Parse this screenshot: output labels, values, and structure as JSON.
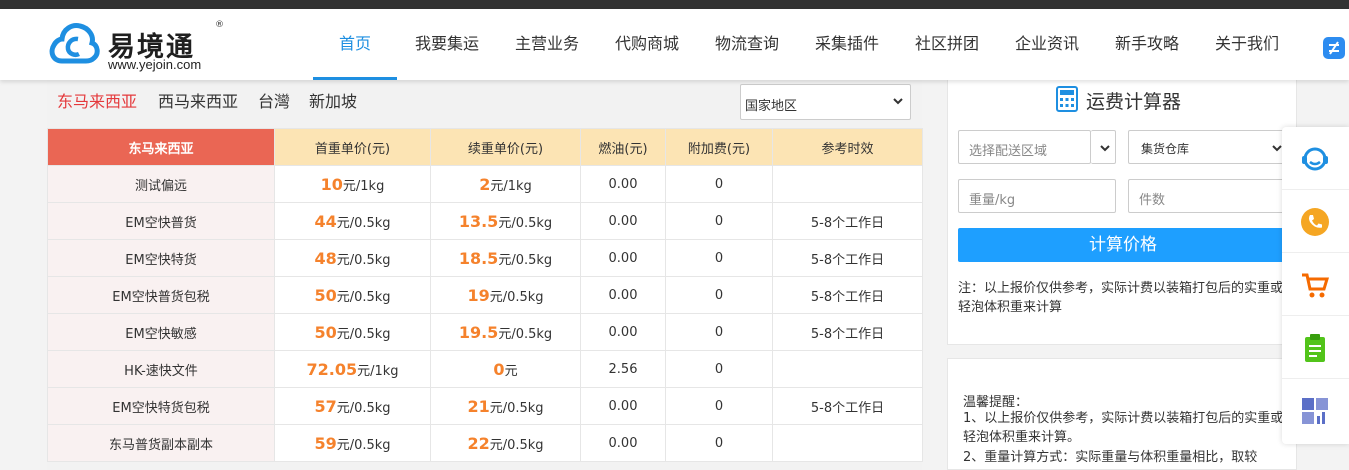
{
  "header": {
    "brand_name": "易境通",
    "brand_reg": "®",
    "brand_url": "www.yejoin.com",
    "nav": [
      {
        "label": "首页",
        "active": true
      },
      {
        "label": "我要集运"
      },
      {
        "label": "主营业务"
      },
      {
        "label": "代购商城"
      },
      {
        "label": "物流查询"
      },
      {
        "label": "采集插件"
      },
      {
        "label": "社区拼团"
      },
      {
        "label": "企业资讯"
      },
      {
        "label": "新手攻略"
      },
      {
        "label": "关于我们"
      }
    ]
  },
  "regions": {
    "tabs": [
      "东马来西亚",
      "西马来西亚",
      "台灣",
      "新加坡"
    ],
    "active": "东马来西亚",
    "select_value": "国家地区"
  },
  "rates_table": {
    "headers": [
      "东马来西亚",
      "首重单价(元)",
      "续重单价(元)",
      "燃油(元)",
      "附加费(元)",
      "参考时效"
    ],
    "rows": [
      {
        "name": "测试偏远",
        "first_price": "10",
        "first_unit": "元/1kg",
        "cont_price": "2",
        "cont_unit": "元/1kg",
        "fuel": "0.00",
        "surcharge": "0",
        "eta": ""
      },
      {
        "name": "EM空快普货",
        "first_price": "44",
        "first_unit": "元/0.5kg",
        "cont_price": "13.5",
        "cont_unit": "元/0.5kg",
        "fuel": "0.00",
        "surcharge": "0",
        "eta": "5-8个工作日"
      },
      {
        "name": "EM空快特货",
        "first_price": "48",
        "first_unit": "元/0.5kg",
        "cont_price": "18.5",
        "cont_unit": "元/0.5kg",
        "fuel": "0.00",
        "surcharge": "0",
        "eta": "5-8个工作日"
      },
      {
        "name": "EM空快普货包税",
        "first_price": "50",
        "first_unit": "元/0.5kg",
        "cont_price": "19",
        "cont_unit": "元/0.5kg",
        "fuel": "0.00",
        "surcharge": "0",
        "eta": "5-8个工作日"
      },
      {
        "name": "EM空快敏感",
        "first_price": "50",
        "first_unit": "元/0.5kg",
        "cont_price": "19.5",
        "cont_unit": "元/0.5kg",
        "fuel": "0.00",
        "surcharge": "0",
        "eta": "5-8个工作日"
      },
      {
        "name": "HK-速快文件",
        "first_price": "72.05",
        "first_unit": "元/1kg",
        "cont_price": "0",
        "cont_unit": "元",
        "fuel": "2.56",
        "surcharge": "0",
        "eta": ""
      },
      {
        "name": "EM空快特货包税",
        "first_price": "57",
        "first_unit": "元/0.5kg",
        "cont_price": "21",
        "cont_unit": "元/0.5kg",
        "fuel": "0.00",
        "surcharge": "0",
        "eta": "5-8个工作日"
      },
      {
        "name": "东马普货副本副本",
        "first_price": "59",
        "first_unit": "元/0.5kg",
        "cont_price": "22",
        "cont_unit": "元/0.5kg",
        "fuel": "0.00",
        "surcharge": "0",
        "eta": ""
      }
    ]
  },
  "calculator": {
    "title": "运费计算器",
    "region_placeholder": "选择配送区域",
    "warehouse_value": "集货仓库",
    "weight_placeholder": "重量/kg",
    "count_placeholder": "件数",
    "button_label": "计算价格",
    "note": "注：以上报价仅供参考，实际计费以装箱打包后的实重或轻泡体积重来计算"
  },
  "tips": {
    "title": "温馨提醒：",
    "line1": "1、以上报价仅供参考，实际计费以装箱打包后的实重或轻泡体积重来计算。",
    "line2": "2、重量计算方式：实际重量与体积重量相比，取较"
  },
  "float_bar": {
    "icons": [
      "customer-service-icon",
      "phone-icon",
      "cart-icon",
      "clipboard-icon",
      "dashboard-icon"
    ]
  },
  "colors": {
    "accent_blue": "#1e8fe1",
    "button_blue": "#1e9fff",
    "header_red": "#ea6654",
    "table_header_yellow": "#fce4b4",
    "price_orange": "#f5822c",
    "active_region_red": "#e4393c"
  }
}
